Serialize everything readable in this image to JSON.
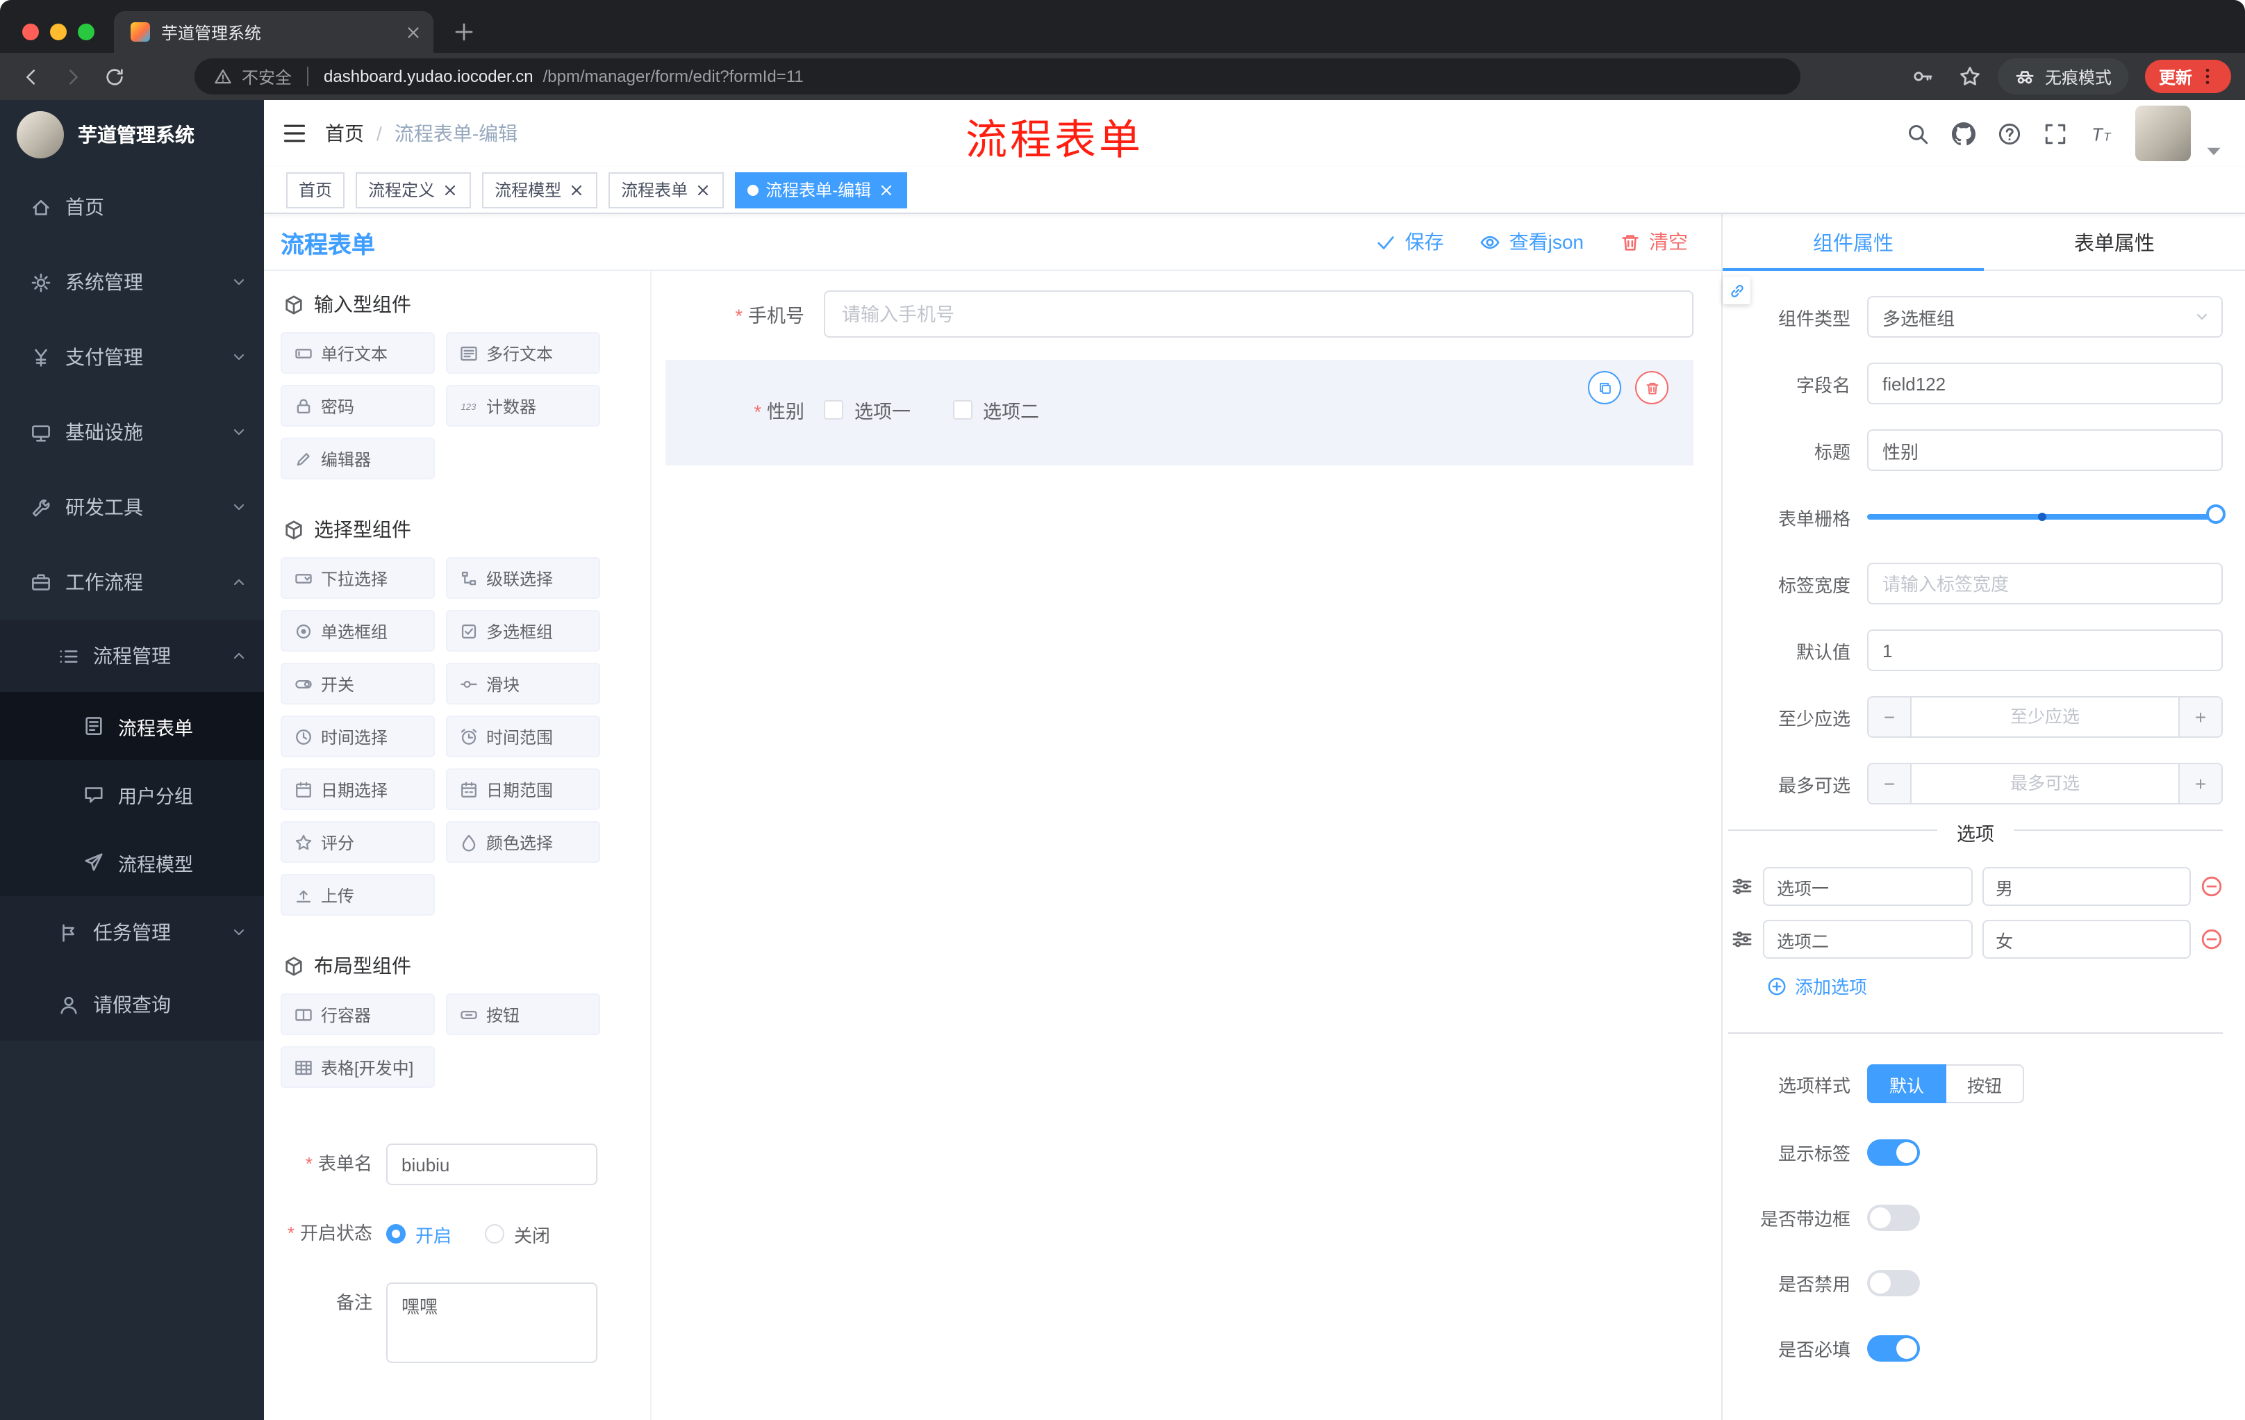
{
  "colors": {
    "accent": "#409eff",
    "danger": "#f56c6c",
    "annotation_red": "#ff1f11",
    "active_tab_bg": "#409eff",
    "sidebar_bg": "#222a35"
  },
  "browser": {
    "tab_title": "芋道管理系统",
    "security_label": "不安全",
    "url_domain": "dashboard.yudao.iocoder.cn",
    "url_path": "/bpm/manager/form/edit?formId=11",
    "incognito_label": "无痕模式",
    "update_label": "更新"
  },
  "sidebar": {
    "logo_title": "芋道管理系统",
    "items": [
      {
        "label": "首页",
        "icon": "home-icon"
      },
      {
        "label": "系统管理",
        "icon": "gear-icon",
        "chevron": "down"
      },
      {
        "label": "支付管理",
        "icon": "yen-icon",
        "chevron": "down"
      },
      {
        "label": "基础设施",
        "icon": "monitor-icon",
        "chevron": "down"
      },
      {
        "label": "研发工具",
        "icon": "tools-icon",
        "chevron": "down"
      },
      {
        "label": "工作流程",
        "icon": "briefcase-icon",
        "chevron": "up"
      },
      {
        "label": "流程管理",
        "icon": "list-icon",
        "chevron": "up"
      },
      {
        "label": "流程表单",
        "icon": "form-icon",
        "active": true
      },
      {
        "label": "用户分组",
        "icon": "chat-icon"
      },
      {
        "label": "流程模型",
        "icon": "send-icon"
      },
      {
        "label": "任务管理",
        "icon": "branch-icon",
        "chevron": "down"
      },
      {
        "label": "请假查询",
        "icon": "user-icon"
      }
    ]
  },
  "header": {
    "breadcrumb_home": "首页",
    "breadcrumb_current": "流程表单-编辑",
    "annotation": "流程表单"
  },
  "tags_view": {
    "tabs": [
      {
        "label": "首页",
        "closable": false
      },
      {
        "label": "流程定义",
        "closable": true
      },
      {
        "label": "流程模型",
        "closable": true
      },
      {
        "label": "流程表单",
        "closable": true
      },
      {
        "label": "流程表单-编辑",
        "closable": true,
        "active": true
      }
    ]
  },
  "designer": {
    "title": "流程表单",
    "actions": {
      "save": "保存",
      "view_json": "查看json",
      "clear": "清空"
    },
    "groups": [
      {
        "title": "输入型组件",
        "items": [
          {
            "label": "单行文本",
            "icon": "input-icon"
          },
          {
            "label": "多行文本",
            "icon": "textarea-icon"
          },
          {
            "label": "密码",
            "icon": "password-icon"
          },
          {
            "label": "计数器",
            "icon": "counter-icon"
          },
          {
            "label": "编辑器",
            "icon": "editor-icon"
          }
        ]
      },
      {
        "title": "选择型组件",
        "items": [
          {
            "label": "下拉选择",
            "icon": "select-icon"
          },
          {
            "label": "级联选择",
            "icon": "cascader-icon"
          },
          {
            "label": "单选框组",
            "icon": "radio-icon"
          },
          {
            "label": "多选框组",
            "icon": "checkbox-icon"
          },
          {
            "label": "开关",
            "icon": "switch-icon"
          },
          {
            "label": "滑块",
            "icon": "slider-icon"
          },
          {
            "label": "时间选择",
            "icon": "time-icon"
          },
          {
            "label": "时间范围",
            "icon": "time-range-icon"
          },
          {
            "label": "日期选择",
            "icon": "date-icon"
          },
          {
            "label": "日期范围",
            "icon": "date-range-icon"
          },
          {
            "label": "评分",
            "icon": "rate-icon"
          },
          {
            "label": "颜色选择",
            "icon": "color-icon"
          },
          {
            "label": "上传",
            "icon": "upload-icon"
          }
        ]
      },
      {
        "title": "布局型组件",
        "items": [
          {
            "label": "行容器",
            "icon": "row-icon"
          },
          {
            "label": "按钮",
            "icon": "button-icon"
          },
          {
            "label": "表格[开发中]",
            "icon": "table-icon"
          }
        ]
      }
    ],
    "meta": {
      "name_label": "表单名",
      "name_value": "biubiu",
      "status_label": "开启状态",
      "status_on": "开启",
      "status_off": "关闭",
      "status_selected": "开启",
      "remark_label": "备注",
      "remark_value": "嘿嘿"
    },
    "canvas": {
      "phone_label": "手机号",
      "phone_placeholder": "请输入手机号",
      "gender_label": "性别",
      "gender_options": [
        "选项一",
        "选项二"
      ]
    }
  },
  "props": {
    "tab_component": "组件属性",
    "tab_form": "表单属性",
    "active_tab": "组件属性",
    "component_type_label": "组件类型",
    "component_type_value": "多选框组",
    "field_name_label": "字段名",
    "field_name_value": "field122",
    "title_label": "标题",
    "title_value": "性别",
    "grid_label": "表单栅格",
    "label_width_label": "标签宽度",
    "label_width_placeholder": "请输入标签宽度",
    "default_label": "默认值",
    "default_value": "1",
    "min_label": "至少应选",
    "min_placeholder": "至少应选",
    "max_label": "最多可选",
    "max_placeholder": "最多可选",
    "options_title": "选项",
    "options": [
      {
        "label": "选项一",
        "value": "男"
      },
      {
        "label": "选项二",
        "value": "女"
      }
    ],
    "add_option": "添加选项",
    "option_style_label": "选项样式",
    "option_style_default": "默认",
    "option_style_button": "按钮",
    "option_style_selected": "默认",
    "toggles": [
      {
        "label": "显示标签",
        "on": true
      },
      {
        "label": "是否带边框",
        "on": false
      },
      {
        "label": "是否禁用",
        "on": false
      },
      {
        "label": "是否必填",
        "on": true
      }
    ]
  }
}
